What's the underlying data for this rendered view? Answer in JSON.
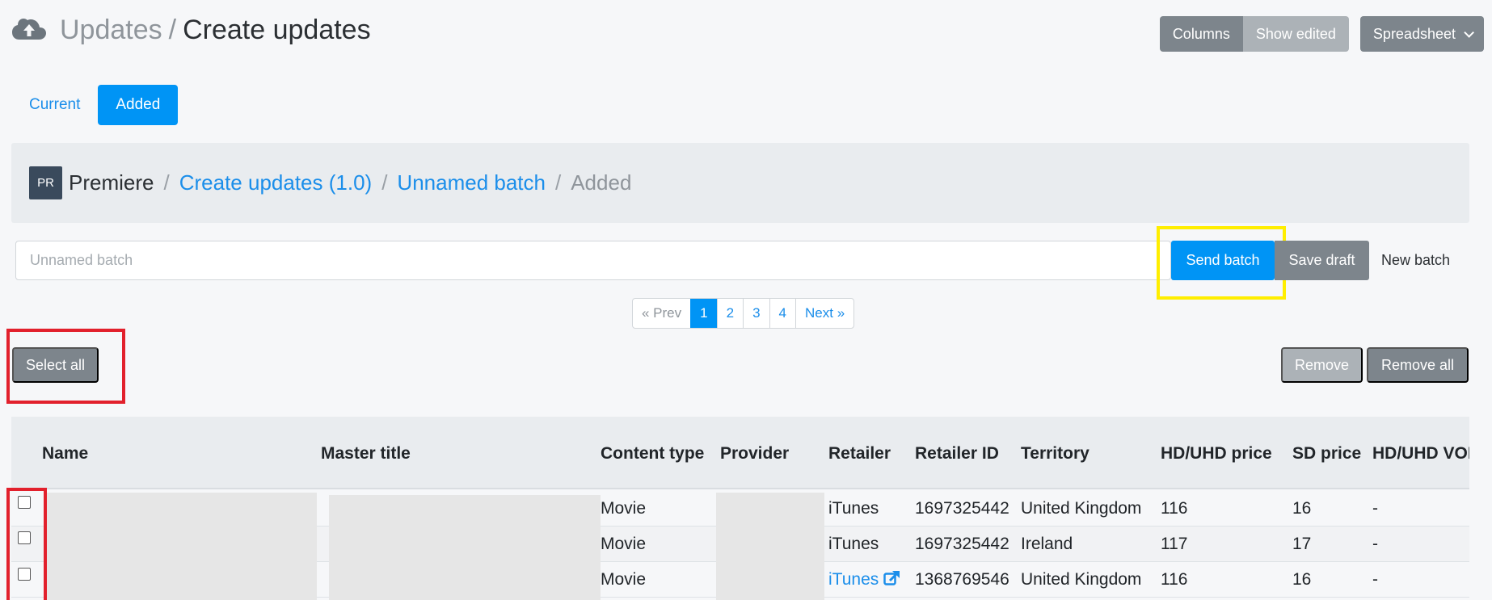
{
  "header": {
    "icon": "cloud-upload-icon",
    "section": "Updates",
    "separator": "/",
    "title": "Create updates"
  },
  "toolbar": {
    "columns_label": "Columns",
    "show_edited_label": "Show edited",
    "spreadsheet_label": "Spreadsheet"
  },
  "tabs": [
    {
      "label": "Current",
      "active": false
    },
    {
      "label": "Added",
      "active": true
    }
  ],
  "breadcrumb": {
    "avatar": "PR",
    "items": [
      "Premiere",
      "Create updates (1.0)",
      "Unnamed batch",
      "Added"
    ],
    "separator": "/"
  },
  "batch": {
    "placeholder": "Unnamed batch",
    "send_label": "Send batch",
    "save_label": "Save draft",
    "new_label": "New batch"
  },
  "pagination": {
    "prev": "« Prev",
    "pages": [
      "1",
      "2",
      "3",
      "4"
    ],
    "current": "1",
    "next": "Next »"
  },
  "actions": {
    "select_all": "Select all",
    "remove": "Remove",
    "remove_all": "Remove all"
  },
  "table": {
    "columns": [
      "Name",
      "Master title",
      "Content type",
      "Provider",
      "Retailer",
      "Retailer ID",
      "Territory",
      "HD/UHD price",
      "SD price",
      "HD/UHD VOD"
    ],
    "rows": [
      {
        "name": "",
        "master_title": "",
        "content_type": "Movie",
        "provider": "",
        "retailer": "iTunes",
        "retailer_link": false,
        "retailer_id": "1697325442",
        "territory": "United Kingdom",
        "hd_price": "116",
        "sd_price": "16",
        "hd_vod": "-"
      },
      {
        "name": "",
        "master_title": "",
        "content_type": "Movie",
        "provider": "",
        "retailer": "iTunes",
        "retailer_link": false,
        "retailer_id": "1697325442",
        "territory": "Ireland",
        "hd_price": "117",
        "sd_price": "17",
        "hd_vod": "-"
      },
      {
        "name": "",
        "master_title": "",
        "content_type": "Movie",
        "provider": "",
        "retailer": "iTunes",
        "retailer_link": true,
        "retailer_id": "1368769546",
        "territory": "United Kingdom",
        "hd_price": "116",
        "sd_price": "16",
        "hd_vod": "-"
      }
    ]
  },
  "colors": {
    "primary": "#0094f5",
    "link": "#1b8eea",
    "secondary": "#7d858c",
    "highlight_yellow": "#ffee00",
    "highlight_red": "#e2202c"
  }
}
